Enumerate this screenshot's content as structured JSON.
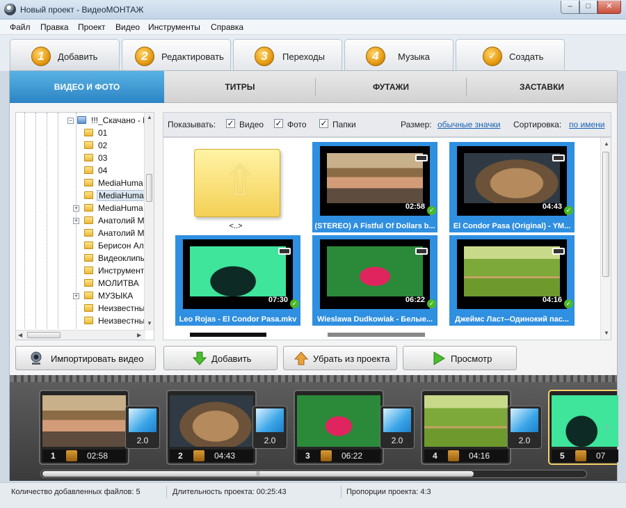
{
  "window": {
    "title": "Новый проект - ВидеоМОНТАЖ",
    "min": "–",
    "max": "□",
    "close": "✕"
  },
  "menu": [
    "Файл",
    "Правка",
    "Проект",
    "Видео",
    "Инструменты",
    "Справка"
  ],
  "main_tabs": [
    {
      "num": "1",
      "label": "Добавить"
    },
    {
      "num": "2",
      "label": "Редактировать"
    },
    {
      "num": "3",
      "label": "Переходы"
    },
    {
      "num": "4",
      "label": "Музыка"
    },
    {
      "num": "✓",
      "label": "Создать"
    }
  ],
  "sub_tabs": [
    "ВИДЕО И ФОТО",
    "ТИТРЫ",
    "ФУТАЖИ",
    "ЗАСТАВКИ"
  ],
  "tree": {
    "root": "!!!_Скачано - M",
    "items": [
      "01",
      "02",
      "03",
      "04",
      "MediaHuma",
      "MediaHuma",
      "MediaHuma",
      "Анатолий M",
      "Анатолий M",
      "Берисон Ал",
      "Видеоклипы",
      "Инструмент",
      "МОЛИТВА",
      "МУЗЫКА",
      "Неизвестны",
      "Неизвестны"
    ],
    "expanders": [
      "",
      "",
      "",
      "",
      "",
      "",
      "+",
      "+",
      "",
      "",
      "",
      "",
      "",
      "+",
      "",
      ""
    ]
  },
  "filter": {
    "show_label": "Показывать:",
    "video": "Видео",
    "photo": "Фото",
    "folders": "Папки",
    "check": "✓",
    "size_label": "Размер:",
    "size_value": "обычные значки",
    "sort_label": "Сортировка:",
    "sort_value": "по имени"
  },
  "files": [
    {
      "name": "<..>",
      "duration": ""
    },
    {
      "name": "(STEREO) A Fistful Of Dollars b...",
      "duration": "02:58"
    },
    {
      "name": "El Condor Pasa (Original) - YM...",
      "duration": "04:43"
    },
    {
      "name": "Leo Rojas - El Condor Pasa.mkv",
      "duration": "07:30"
    },
    {
      "name": "Wieslawa Dudkowiak -  Белые...",
      "duration": "06:22"
    },
    {
      "name": "Джеймс Ласт--Одинокий пас...",
      "duration": "04:16"
    }
  ],
  "buttons": {
    "import": "Импортировать видео",
    "add": "Добавить",
    "remove": "Убрать из проекта",
    "preview": "Просмотр"
  },
  "timeline": {
    "clips": [
      {
        "num": "1",
        "duration": "02:58"
      },
      {
        "num": "2",
        "duration": "04:43"
      },
      {
        "num": "3",
        "duration": "06:22"
      },
      {
        "num": "4",
        "duration": "04:16"
      },
      {
        "num": "5",
        "duration": "07"
      }
    ],
    "transitions": [
      "2.0",
      "2.0",
      "2.0",
      "2.0"
    ],
    "scroll_grip": "|||"
  },
  "status": {
    "files": "Количество добавленных файлов: 5",
    "duration": "Длительность проекта:  00:25:43",
    "ratio": "Пропорции проекта:  4:3"
  }
}
